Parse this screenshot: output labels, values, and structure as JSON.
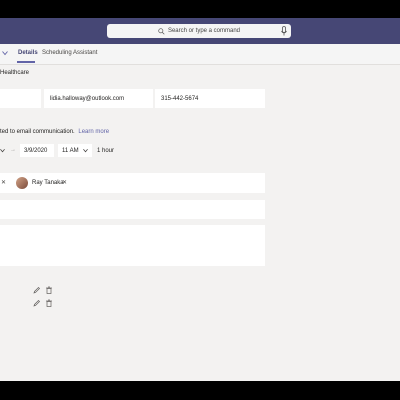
{
  "search": {
    "placeholder": "Search or type a command"
  },
  "tabs": [
    {
      "label": "Details",
      "active": true
    },
    {
      "label": "Scheduling Assistant",
      "active": false
    }
  ],
  "contact": {
    "company": "Healthcare",
    "email": "lidia.halloway@outlook.com",
    "phone": "315-442-5674"
  },
  "note": {
    "text": "ted to email communication.",
    "link": "Learn more"
  },
  "schedule": {
    "end_date": "3/9/2020",
    "end_time": "11 AM",
    "duration": "1 hour"
  },
  "attendees": [
    {
      "name": "Ray Tanaka"
    }
  ],
  "colors": {
    "header": "#464775",
    "accent": "#6264a7",
    "background": "#f3f2f1"
  }
}
